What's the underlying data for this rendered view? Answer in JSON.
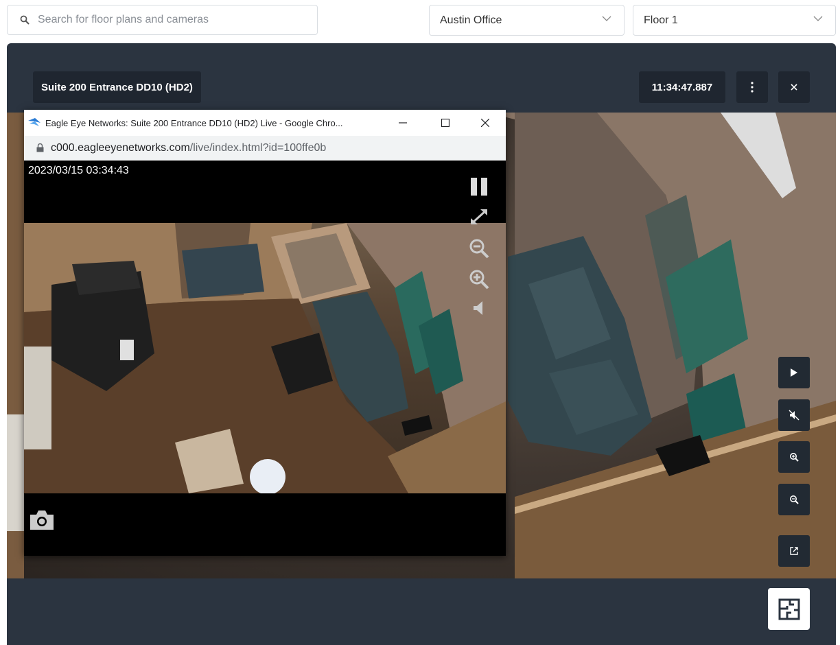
{
  "search": {
    "placeholder": "Search for floor plans and cameras"
  },
  "location_select": {
    "value": "Austin Office"
  },
  "floor_select": {
    "value": "Floor 1"
  },
  "camera": {
    "title": "Suite 200 Entrance DD10 (HD2)",
    "time": "11:34:47.887"
  },
  "popup": {
    "window_title": "Eagle Eye Networks: Suite 200 Entrance DD10 (HD2) Live - Google Chro...",
    "url_host": "c000.eagleeyenetworks.com",
    "url_path": "/live/index.html?id=100ffe0b",
    "timestamp": "2023/03/15 03:34:43"
  },
  "icons": {
    "search": "search-icon",
    "chevron": "chevron-down-icon",
    "more": "more-vertical-icon",
    "close": "close-icon",
    "play": "play-icon",
    "mute": "volume-off-icon",
    "zoom_in": "zoom-in-icon",
    "zoom_out": "zoom-out-icon",
    "open_external": "open-in-new-icon",
    "floor_plan": "floor-plan-icon"
  },
  "colors": {
    "panel": "#2b3440",
    "badge": "#1f2630",
    "control": "#222a33"
  }
}
